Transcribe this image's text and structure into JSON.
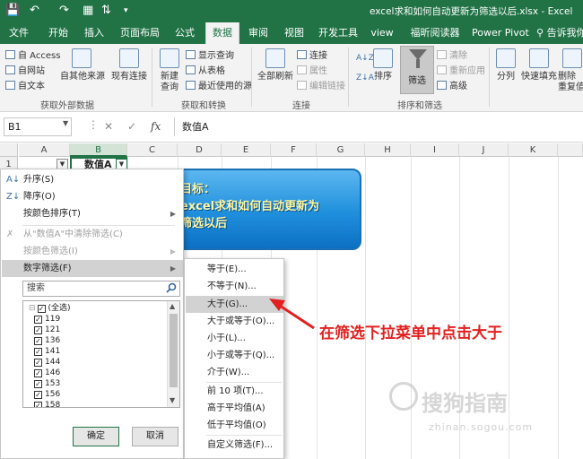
{
  "window": {
    "title": "excel求和如何自动更新为筛选以后.xlsx - Excel",
    "qa_icons": [
      "save-icon",
      "undo-icon",
      "redo-icon",
      "print-preview-icon",
      "sort-icon",
      "customize-icon"
    ]
  },
  "tabs": [
    "文件",
    "开始",
    "插入",
    "页面布局",
    "公式",
    "数据",
    "审阅",
    "视图",
    "开发工具",
    "view",
    "福昕阅读器",
    "Power Pivot",
    "告诉我你"
  ],
  "active_tab": "数据",
  "ribbon": {
    "ext_data": {
      "items": [
        "自 Access",
        "自网站",
        "自文本"
      ],
      "other_sources": "自其他来源",
      "existing": "现有连接",
      "label": "获取外部数据"
    },
    "get_transform": {
      "new_query": "新建",
      "new_query2": "查询",
      "items": [
        "显示查询",
        "从表格",
        "最近使用的源"
      ],
      "label": "获取和转换"
    },
    "connections": {
      "refresh_all": "全部刷新",
      "items": [
        "连接",
        "属性",
        "编辑链接"
      ],
      "label": "连接"
    },
    "sort_filter": {
      "sort": "排序",
      "filter": "筛选",
      "items": [
        "清除",
        "重新应用",
        "高级"
      ],
      "label": "排序和筛选"
    },
    "tools": [
      "分列",
      "快速填充",
      "删除",
      "重复值"
    ]
  },
  "formula_bar": {
    "name_box": "B1",
    "fx": "fx",
    "content": "数值A"
  },
  "columns": [
    "A",
    "B",
    "C",
    "D",
    "E",
    "F",
    "G",
    "H",
    "I",
    "J",
    "K"
  ],
  "rows": [
    "1"
  ],
  "cell_b1": "数值A",
  "callout_lines": [
    "目标：",
    "excel求和如何自动更新为",
    "筛选以后"
  ],
  "filter_menu": {
    "sort_asc": "升序(S)",
    "sort_desc": "降序(O)",
    "sort_color": "按颜色排序(T)",
    "clear": "从\"数值A\"中清除筛选(C)",
    "filter_color": "按颜色筛选(I)",
    "number_filter": "数字筛选(F)",
    "search_placeholder": "搜索",
    "list": [
      "(全选)",
      "119",
      "121",
      "136",
      "141",
      "144",
      "146",
      "153",
      "156",
      "158"
    ],
    "ok": "确定",
    "cancel": "取消"
  },
  "submenu": {
    "items": [
      "等于(E)...",
      "不等于(N)...",
      "大于(G)...",
      "大于或等于(O)...",
      "小于(L)...",
      "小于或等于(Q)...",
      "介于(W)...",
      "前 10 项(T)...",
      "高于平均值(A)",
      "低于平均值(O)",
      "自定义筛选(F)..."
    ],
    "highlighted": "大于(G)..."
  },
  "annotation": "在筛选下拉菜单中点击大于",
  "watermark": {
    "text": "搜狗指南",
    "sub": "zhinan.sogou.com"
  },
  "colors": {
    "excel_green": "#217346",
    "annotation_red": "#e32020",
    "callout_blue": "#1f8fdc",
    "callout_text": "#fff6a0"
  }
}
